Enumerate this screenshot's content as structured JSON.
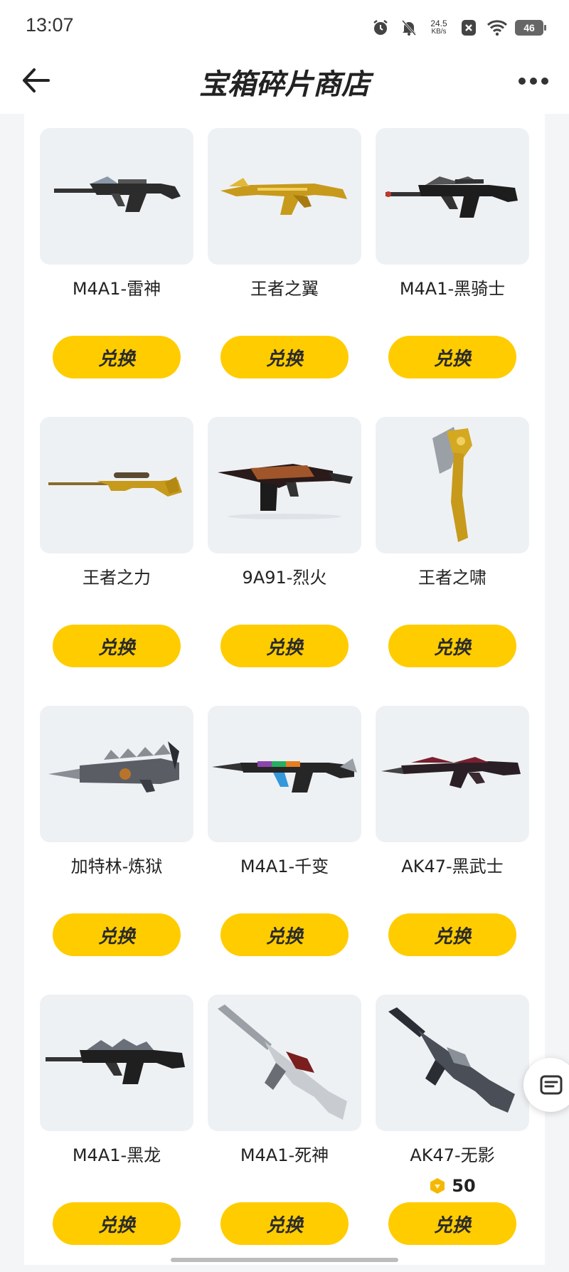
{
  "status_bar": {
    "time": "13:07",
    "net_speed": "24.5",
    "net_unit": "KB/s",
    "battery": "46",
    "icons": [
      "alarm-icon",
      "mute-bell-icon",
      "net-speed",
      "app-notification-icon",
      "wifi-icon",
      "battery-icon"
    ]
  },
  "header": {
    "title": "宝箱碎片商店",
    "back_icon": "arrow-left-icon",
    "more_icon": "more-dots-icon"
  },
  "items": [
    {
      "name": "M4A1-雷神",
      "button": "兑换",
      "price": ""
    },
    {
      "name": "王者之翼",
      "button": "兑换",
      "price": ""
    },
    {
      "name": "M4A1-黑骑士",
      "button": "兑换",
      "price": ""
    },
    {
      "name": "王者之力",
      "button": "兑换",
      "price": ""
    },
    {
      "name": "9A91-烈火",
      "button": "兑换",
      "price": ""
    },
    {
      "name": "王者之啸",
      "button": "兑换",
      "price": ""
    },
    {
      "name": "加特林-炼狱",
      "button": "兑换",
      "price": ""
    },
    {
      "name": "M4A1-千变",
      "button": "兑换",
      "price": ""
    },
    {
      "name": "AK47-黑武士",
      "button": "兑换",
      "price": ""
    },
    {
      "name": "M4A1-黑龙",
      "button": "兑换",
      "price": ""
    },
    {
      "name": "M4A1-死神",
      "button": "兑换",
      "price": ""
    },
    {
      "name": "AK47-无影",
      "button": "兑换",
      "price": "50"
    }
  ],
  "floating_button_icon": "message-box-icon",
  "colors": {
    "accent": "#ffcc00",
    "thumb_bg": "#eef1f4",
    "page_bg": "#f4f5f7",
    "coin": "#f5b800"
  }
}
